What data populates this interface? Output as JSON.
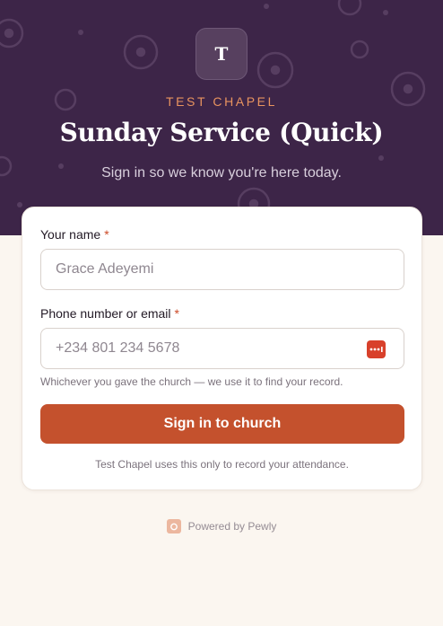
{
  "header": {
    "logo_letter": "T",
    "church_name": "TEST CHAPEL",
    "title": "Sunday Service (Quick)",
    "subtitle": "Sign in so we know you're here today."
  },
  "form": {
    "name": {
      "label": "Your name",
      "required_mark": "*",
      "placeholder": "Grace Adeyemi",
      "value": ""
    },
    "contact": {
      "label": "Phone number or email",
      "required_mark": "*",
      "placeholder": "+234 801 234 5678",
      "value": "",
      "hint": "Whichever you gave the church — we use it to find your record.",
      "autofill_icon": "password-manager-icon"
    },
    "submit_label": "Sign in to church",
    "privacy_note": "Test Chapel uses this only to record your attendance."
  },
  "footer": {
    "powered_by": "Powered by Pewly",
    "brand_icon": "pewly-logo-icon"
  },
  "colors": {
    "hero_background": "#3d2548",
    "accent": "#c4512d",
    "eyebrow": "#e8935f",
    "page_background": "#fbf6f0"
  }
}
